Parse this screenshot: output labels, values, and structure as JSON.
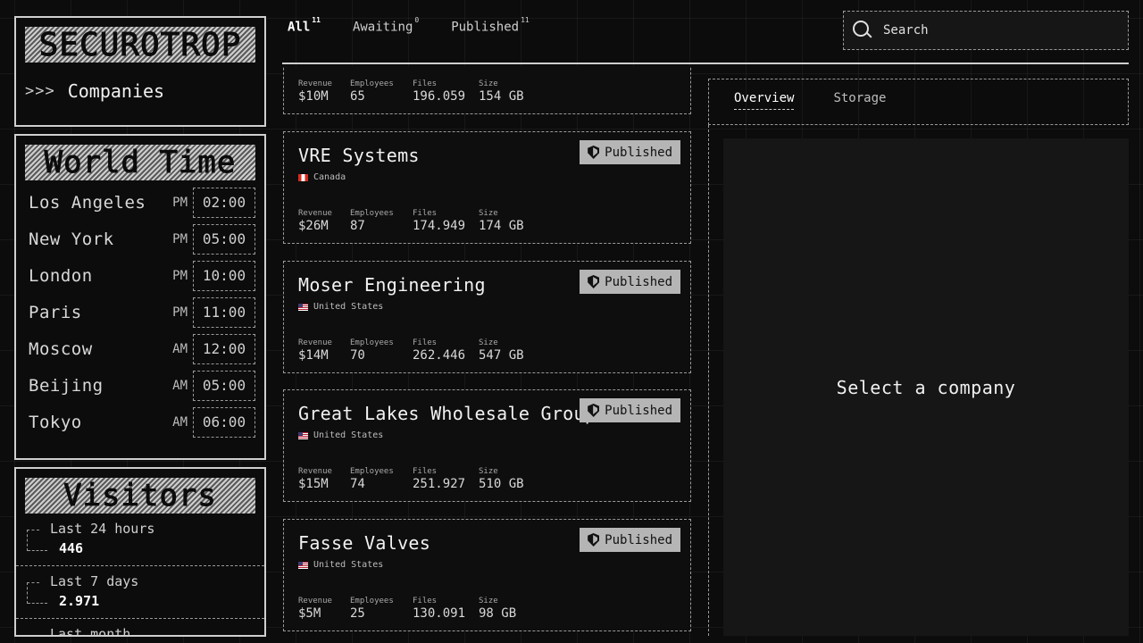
{
  "app": {
    "logo": "SECUROTROP",
    "nav_arrows": ">>>",
    "nav_label": "Companies"
  },
  "world_time": {
    "title": "World Time",
    "zones": [
      {
        "city": "Los Angeles",
        "ampm": "PM",
        "time": "02:00"
      },
      {
        "city": "New York",
        "ampm": "PM",
        "time": "05:00"
      },
      {
        "city": "London",
        "ampm": "PM",
        "time": "10:00"
      },
      {
        "city": "Paris",
        "ampm": "PM",
        "time": "11:00"
      },
      {
        "city": "Moscow",
        "ampm": "AM",
        "time": "12:00"
      },
      {
        "city": "Beijing",
        "ampm": "AM",
        "time": "05:00"
      },
      {
        "city": "Tokyo",
        "ampm": "AM",
        "time": "06:00"
      }
    ]
  },
  "visitors": {
    "title": "Visitors",
    "items": [
      {
        "label": "Last 24 hours",
        "value": "446"
      },
      {
        "label": "Last 7 days",
        "value": "2.971"
      },
      {
        "label": "Last month",
        "value": ""
      }
    ]
  },
  "filters": {
    "tabs": [
      {
        "label": "All",
        "count": "11"
      },
      {
        "label": "Awaiting",
        "count": "0"
      },
      {
        "label": "Published",
        "count": "11"
      }
    ]
  },
  "search": {
    "placeholder": "Search"
  },
  "stat_labels": {
    "revenue": "Revenue",
    "employees": "Employees",
    "files": "Files",
    "size": "Size"
  },
  "companies": [
    {
      "name": "",
      "country": "",
      "status": "",
      "revenue": "$10M",
      "employees": "65",
      "files": "196.059",
      "size": "154 GB"
    },
    {
      "name": "VRE Systems",
      "country": "Canada",
      "status": "Published",
      "revenue": "$26M",
      "employees": "87",
      "files": "174.949",
      "size": "174 GB"
    },
    {
      "name": "Moser Engineering",
      "country": "United States",
      "status": "Published",
      "revenue": "$14M",
      "employees": "70",
      "files": "262.446",
      "size": "547 GB"
    },
    {
      "name": "Great Lakes Wholesale Group",
      "country": "United States",
      "status": "Published",
      "revenue": "$15M",
      "employees": "74",
      "files": "251.927",
      "size": "510 GB"
    },
    {
      "name": "Fasse Valves",
      "country": "United States",
      "status": "Published",
      "revenue": "$5M",
      "employees": "25",
      "files": "130.091",
      "size": "98 GB"
    }
  ],
  "detail": {
    "tabs": [
      {
        "label": "Overview"
      },
      {
        "label": "Storage"
      }
    ],
    "empty_message": "Select a company"
  }
}
